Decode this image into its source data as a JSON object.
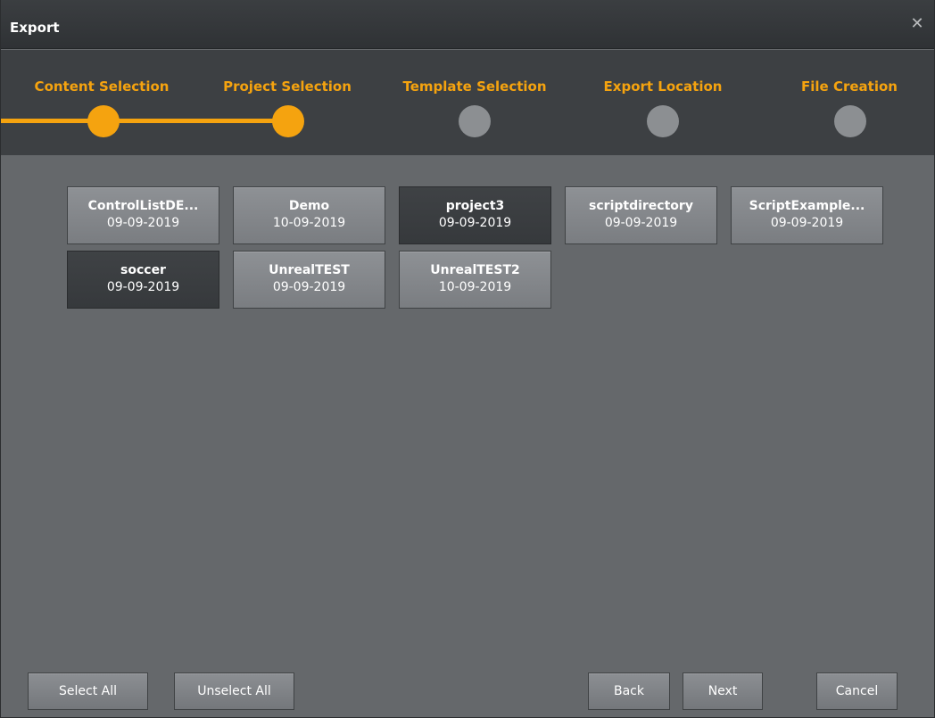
{
  "window": {
    "title": "Export",
    "close_glyph": "✕"
  },
  "steps": [
    {
      "label": "Content Selection",
      "status": "done"
    },
    {
      "label": "Project Selection",
      "status": "done"
    },
    {
      "label": "Template Selection",
      "status": "pending"
    },
    {
      "label": "Export Location",
      "status": "pending"
    },
    {
      "label": "File Creation",
      "status": "pending"
    }
  ],
  "projects": [
    {
      "name": "ControlListDE...",
      "date": "09-09-2019",
      "selected": false
    },
    {
      "name": "Demo",
      "date": "10-09-2019",
      "selected": false
    },
    {
      "name": "project3",
      "date": "09-09-2019",
      "selected": true
    },
    {
      "name": "scriptdirectory",
      "date": "09-09-2019",
      "selected": false
    },
    {
      "name": "ScriptExample...",
      "date": "09-09-2019",
      "selected": false
    },
    {
      "name": "soccer",
      "date": "09-09-2019",
      "selected": true
    },
    {
      "name": "UnrealTEST",
      "date": "09-09-2019",
      "selected": false
    },
    {
      "name": "UnrealTEST2",
      "date": "10-09-2019",
      "selected": false
    }
  ],
  "footer": {
    "select_all": "Select All",
    "unselect_all": "Unselect All",
    "back": "Back",
    "next": "Next",
    "cancel": "Cancel"
  },
  "colors": {
    "accent": "#f5a30f",
    "pending_dot": "#8c8f92",
    "panel_bg": "#65686b",
    "header_bg": "#3d4043"
  }
}
